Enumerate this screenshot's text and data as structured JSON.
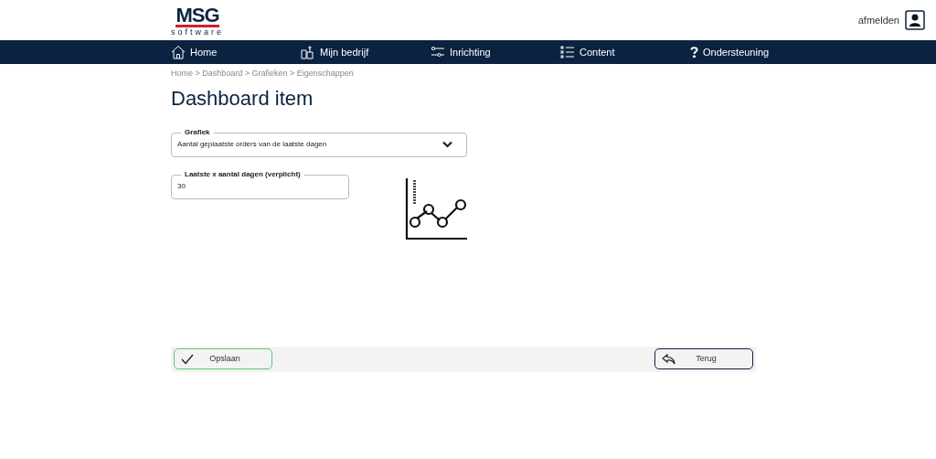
{
  "logo": {
    "name": "MSG",
    "tagline": "software"
  },
  "user": {
    "logout": "afmelden"
  },
  "nav": [
    {
      "kind": "home",
      "label": "Home"
    },
    {
      "kind": "company",
      "label": "Mijn bedrijf"
    },
    {
      "kind": "settings",
      "label": "Inrichting"
    },
    {
      "kind": "list",
      "label": "Content"
    },
    {
      "kind": "help",
      "label": "Ondersteuning"
    }
  ],
  "breadcrumb": "Home > Dashboard > Grafieken > Eigenschappen",
  "title": "Dashboard item",
  "chart_select": {
    "label": "Grafiek",
    "value": "Aantal geplaatste orders van de laatste dagen"
  },
  "days_field": {
    "label": "Laatste x aantal dagen (verplicht)",
    "value": "30"
  },
  "buttons": [
    {
      "kind": "save",
      "label": "Opslaan"
    },
    {
      "kind": "back",
      "label": "Terug"
    }
  ]
}
